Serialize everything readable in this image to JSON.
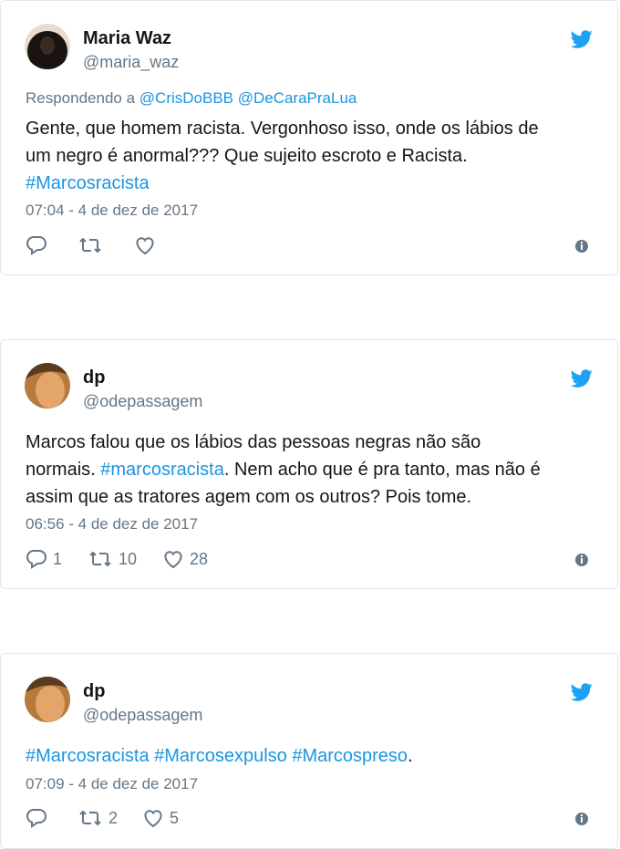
{
  "tweets": [
    {
      "name": "Maria Waz",
      "handle": "@maria_waz",
      "reply_prefix": "Respondendo a",
      "reply_users": "@CrisDoBBB @DeCaraPraLua",
      "line1": "Gente, que homem racista. Vergonhoso isso, onde os lábios de",
      "line2": "um negro é anormal??? Que sujeito escroto e Racista.",
      "hashtag": "#Marcosracista",
      "date": "07:04 - 4 de dez de 2017",
      "replies": "",
      "retweets": "",
      "likes": ""
    },
    {
      "name": "dp",
      "handle": "@odepassagem",
      "line1": "Marcos falou que os lábios das pessoas negras não são",
      "line2_pre": "normais. ",
      "line2_tag": "#marcosracista",
      "line2_post": ". Nem acho que é pra tanto, mas não é",
      "line3": "assim que as tratores agem com os outros? Pois tome.",
      "date": "06:56 - 4 de dez de 2017",
      "replies": "1",
      "retweets": "10",
      "likes": "28"
    },
    {
      "name": "dp",
      "handle": "@odepassagem",
      "tags": "#Marcosracista #Marcosexpulso #Marcospreso",
      "tail": ".",
      "date": "07:09 - 4 de dez de 2017",
      "replies": "",
      "retweets": "2",
      "likes": "5"
    }
  ],
  "colors": {
    "link": "#1b95e0",
    "secondary": "#657786",
    "text": "#14171a",
    "border": "#e1e8ed"
  },
  "icons": [
    "twitter-bird-icon",
    "reply-icon",
    "retweet-icon",
    "heart-icon",
    "info-icon"
  ]
}
